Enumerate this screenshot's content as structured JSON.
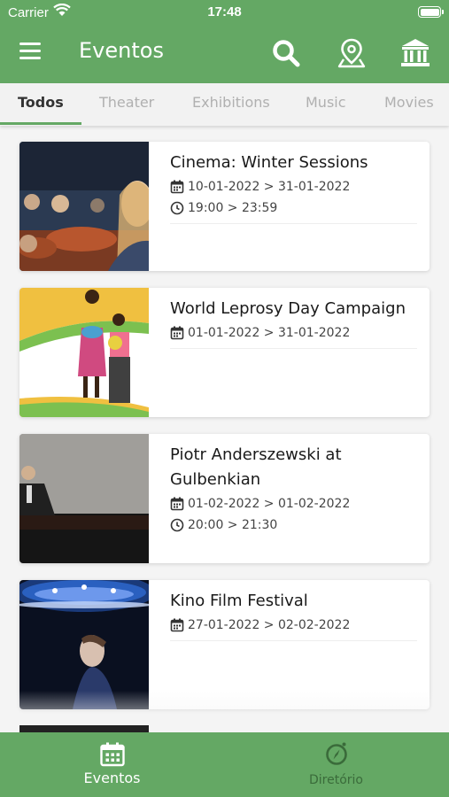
{
  "status_bar": {
    "carrier": "Carrier",
    "time": "17:48"
  },
  "app_bar": {
    "title": "Eventos",
    "icons": [
      "menu-icon",
      "search-icon",
      "map-pin-icon",
      "museum-icon"
    ]
  },
  "tabs": [
    {
      "label": "Todos",
      "active": true
    },
    {
      "label": "Theater",
      "active": false
    },
    {
      "label": "Exhibitions",
      "active": false
    },
    {
      "label": "Music",
      "active": false
    },
    {
      "label": "Movies",
      "active": false
    }
  ],
  "events": [
    {
      "title_lines": [
        "Cinema: Winter Sessions"
      ],
      "dates": "10-01-2022 > 31-01-2022",
      "time": "19:00 > 23:59"
    },
    {
      "title_lines": [
        "World Leprosy Day Campaign"
      ],
      "dates": "01-01-2022 > 31-01-2022",
      "time": ""
    },
    {
      "title_lines": [
        "Piotr Anderszewski at",
        "Gulbenkian"
      ],
      "dates": "01-02-2022 > 01-02-2022",
      "time": "20:00 > 21:30"
    },
    {
      "title_lines": [
        "Kino Film Festival"
      ],
      "dates": "27-01-2022 > 02-02-2022",
      "time": ""
    }
  ],
  "bottom_nav": [
    {
      "label": "Eventos",
      "active": true
    },
    {
      "label": "Diretório",
      "active": false
    }
  ],
  "colors": {
    "primary": "#64a864",
    "inactive_nav": "#3a6b3a"
  }
}
